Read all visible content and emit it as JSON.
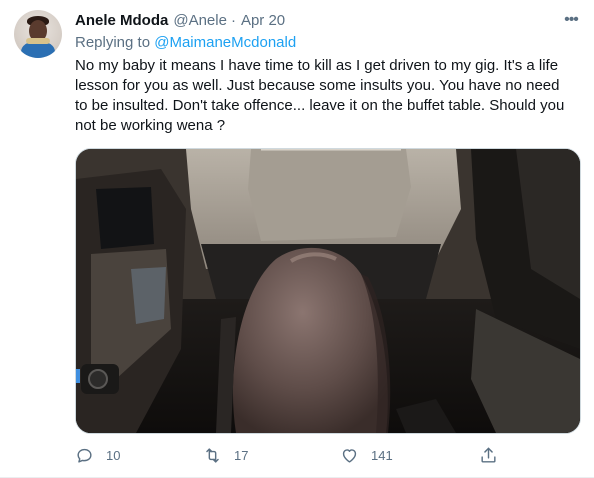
{
  "author": {
    "name": "Anele Mdoda",
    "handle": "@Anele",
    "separator": "·",
    "date": "Apr 20"
  },
  "reply": {
    "prefix": "Replying to",
    "mention": "@MaimaneMcdonald"
  },
  "tweet_text": "No my baby it means I have time to kill as I get driven to my gig. It's a life lesson for you as well. Just because some insults you. You have no need to be insulted. Don't take offence... leave it on the buffet table. Should you not be working wena ?",
  "media": {
    "type": "photo"
  },
  "actions": {
    "replies": "10",
    "retweets": "17",
    "likes": "141"
  },
  "icons": {
    "more": "more-icon",
    "reply": "reply-icon",
    "retweet": "retweet-icon",
    "like": "heart-icon",
    "share": "share-icon"
  },
  "colors": {
    "text_primary": "#0f1419",
    "text_secondary": "#5b7083",
    "link": "#1da1f2",
    "border": "#cfd9de"
  }
}
